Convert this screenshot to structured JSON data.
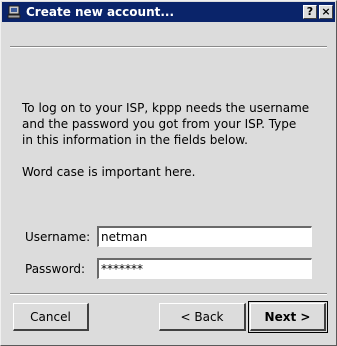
{
  "window": {
    "title": "Create new account...",
    "help_button": "?",
    "close_button": "×"
  },
  "intro": {
    "lines": [
      "To log on to your ISP, kppp needs the username",
      "and the password you got from your ISP. Type",
      "in this information in the fields below."
    ],
    "note": "Word case is important here."
  },
  "form": {
    "username_label": "Username:",
    "username_value": "netman",
    "password_label": "Password:",
    "password_value": "*******"
  },
  "buttons": {
    "cancel": "Cancel",
    "back": "< Back",
    "next": "Next >"
  }
}
